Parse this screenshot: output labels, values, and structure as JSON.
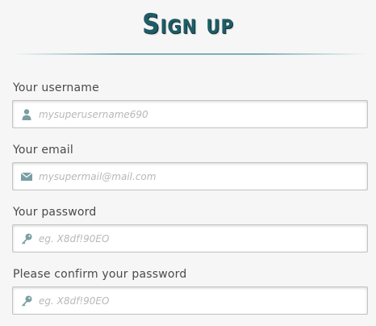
{
  "header": {
    "title": "Sign up"
  },
  "form": {
    "username": {
      "label": "Your username",
      "placeholder": "mysuperusername690",
      "icon": "user-icon"
    },
    "email": {
      "label": "Your email",
      "placeholder": "mysupermail@mail.com",
      "icon": "envelope-icon"
    },
    "password": {
      "label": "Your password",
      "placeholder": "eg. X8df!90EO",
      "icon": "key-icon"
    },
    "confirm_password": {
      "label": "Please confirm your password",
      "placeholder": "eg. X8df!90EO",
      "icon": "key-icon"
    }
  },
  "colors": {
    "title": "#1f5c66",
    "icon": "#7a9ea3",
    "background": "#f6f6f6"
  }
}
